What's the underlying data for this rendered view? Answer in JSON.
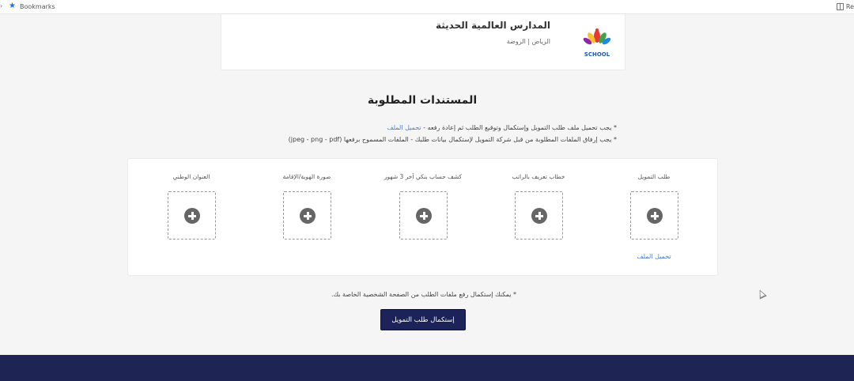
{
  "bookmarks_bar": {
    "bookmarks_label": "Bookmarks",
    "right_label": "Re"
  },
  "school": {
    "name": "المدارس العالمية الحديثة",
    "location": "الرياض | الروضة",
    "logo_text": "SCHOOL"
  },
  "section": {
    "title": "المستندات المطلوبة"
  },
  "instructions": {
    "line1": "* يجب تحميل ملف طلب التمويل وإستكمال وتوقيع الطلب ثم إعادة رفعه - ",
    "line1_link": "تحميل الملف",
    "line2": "* يجب إرفاق الملفات المطلوبة من قبل شركة التمويل لإستكمال بيانات طلبك - الملفات المسموح برفعها (jpeg - png - pdf)"
  },
  "documents": [
    {
      "label": "طلب التمويل"
    },
    {
      "label": "خطاب تعريف بالراتب"
    },
    {
      "label": "كشف حساب بنكي آخر 3 شهور"
    },
    {
      "label": "صورة الهوية/الإقامة"
    },
    {
      "label": "العنوان الوطني"
    }
  ],
  "upload_link": "تحميل الملف",
  "note": "* يمكنك إستكمال رفع ملفات الطلب من الصفحة الشخصية الخاصة بك.",
  "continue_button": "إستكمال طلب التمويل",
  "icons": {
    "bookmark": "star-icon",
    "upload": "plus-circle-icon",
    "cursor": "mouse-pointer-icon"
  },
  "colors": {
    "accent": "#1c2358",
    "link": "#4a7fd4",
    "footer": "#1e2454"
  }
}
